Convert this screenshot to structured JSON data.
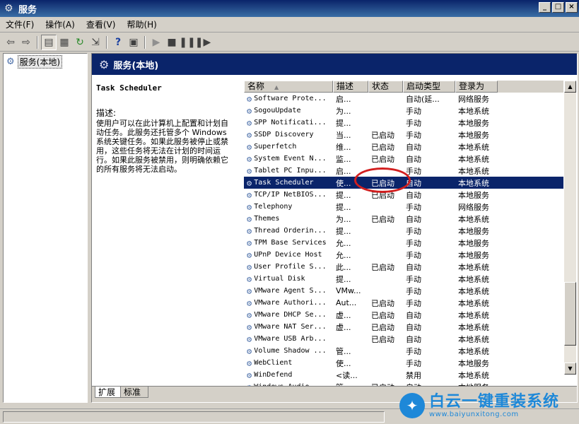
{
  "window": {
    "title": "服务",
    "btn_minimize": "_",
    "btn_maximize": "□",
    "btn_close": "×"
  },
  "menu": [
    {
      "label": "文件(F)"
    },
    {
      "label": "操作(A)"
    },
    {
      "label": "查看(V)"
    },
    {
      "label": "帮助(H)"
    }
  ],
  "toolbar": {
    "icons": [
      "back-icon",
      "forward-icon",
      "show-hide-tree-icon",
      "properties-icon",
      "refresh-icon",
      "export-icon",
      "help-icon",
      "details-view-icon",
      "play-icon",
      "stop-icon",
      "pause-icon",
      "restart-icon"
    ]
  },
  "tree": {
    "root_label": "服务(本地)"
  },
  "header": {
    "title": "服务(本地)"
  },
  "description_pane": {
    "service_name": "Task Scheduler",
    "desc_label": "描述:",
    "desc_text": "使用户可以在此计算机上配置和计划自动任务。此服务还托管多个 Windows 系统关键任务。如果此服务被停止或禁用，这些任务将无法在计划的时间运行。如果此服务被禁用，则明确依赖它的所有服务将无法启动。"
  },
  "columns": [
    "名称",
    "描述",
    "状态",
    "启动类型",
    "登录为"
  ],
  "services": [
    {
      "name": "Software Prote...",
      "desc": "启...",
      "status": "",
      "startup": "自动(延...",
      "logon": "网络服务"
    },
    {
      "name": "SogouUpdate",
      "desc": "为...",
      "status": "",
      "startup": "手动",
      "logon": "本地系统"
    },
    {
      "name": "SPP Notificati...",
      "desc": "提...",
      "status": "",
      "startup": "手动",
      "logon": "本地服务"
    },
    {
      "name": "SSDP Discovery",
      "desc": "当...",
      "status": "已启动",
      "startup": "手动",
      "logon": "本地服务"
    },
    {
      "name": "Superfetch",
      "desc": "维...",
      "status": "已启动",
      "startup": "自动",
      "logon": "本地系统"
    },
    {
      "name": "System Event N...",
      "desc": "监...",
      "status": "已启动",
      "startup": "自动",
      "logon": "本地系统"
    },
    {
      "name": "Tablet PC Inpu...",
      "desc": "启...",
      "status": "",
      "startup": "手动",
      "logon": "本地系统"
    },
    {
      "name": "Task Scheduler",
      "desc": "使...",
      "status": "已启动",
      "startup": "自动",
      "logon": "本地系统",
      "selected": true
    },
    {
      "name": "TCP/IP NetBIOS...",
      "desc": "提...",
      "status": "已启动",
      "startup": "自动",
      "logon": "本地服务"
    },
    {
      "name": "Telephony",
      "desc": "提...",
      "status": "",
      "startup": "手动",
      "logon": "网络服务"
    },
    {
      "name": "Themes",
      "desc": "为...",
      "status": "已启动",
      "startup": "自动",
      "logon": "本地系统"
    },
    {
      "name": "Thread Orderin...",
      "desc": "提...",
      "status": "",
      "startup": "手动",
      "logon": "本地服务"
    },
    {
      "name": "TPM Base Services",
      "desc": "允...",
      "status": "",
      "startup": "手动",
      "logon": "本地服务"
    },
    {
      "name": "UPnP Device Host",
      "desc": "允...",
      "status": "",
      "startup": "手动",
      "logon": "本地服务"
    },
    {
      "name": "User Profile S...",
      "desc": "此...",
      "status": "已启动",
      "startup": "自动",
      "logon": "本地系统"
    },
    {
      "name": "Virtual Disk",
      "desc": "提...",
      "status": "",
      "startup": "手动",
      "logon": "本地系统"
    },
    {
      "name": "VMware Agent S...",
      "desc": "VMw...",
      "status": "",
      "startup": "手动",
      "logon": "本地系统"
    },
    {
      "name": "VMware Authori...",
      "desc": "Aut...",
      "status": "已启动",
      "startup": "手动",
      "logon": "本地系统"
    },
    {
      "name": "VMware DHCP Se...",
      "desc": "虚...",
      "status": "已启动",
      "startup": "自动",
      "logon": "本地系统"
    },
    {
      "name": "VMware NAT Ser...",
      "desc": "虚...",
      "status": "已启动",
      "startup": "自动",
      "logon": "本地系统"
    },
    {
      "name": "VMware USB Arb...",
      "desc": "",
      "status": "已启动",
      "startup": "自动",
      "logon": "本地系统"
    },
    {
      "name": "Volume Shadow ...",
      "desc": "管...",
      "status": "",
      "startup": "手动",
      "logon": "本地系统"
    },
    {
      "name": "WebClient",
      "desc": "使...",
      "status": "",
      "startup": "手动",
      "logon": "本地服务"
    },
    {
      "name": "WinDefend",
      "desc": "<读...",
      "status": "",
      "startup": "禁用",
      "logon": "本地系统"
    },
    {
      "name": "Windows Audio",
      "desc": "管...",
      "status": "已启动",
      "startup": "自动",
      "logon": "本地服务"
    }
  ],
  "scroll": {
    "up_arrow": "▲",
    "down_arrow": "▼"
  },
  "tabs": [
    {
      "label": "扩展"
    },
    {
      "label": "标准"
    }
  ],
  "watermark": {
    "text": "白云一键重装系统",
    "url": "www.baiyunxitong.com"
  },
  "colors": {
    "title_bar": "#0a246a",
    "selected_row": "#0a246a",
    "highlight_circle": "#d21f1f",
    "watermark_blue": "#1e88d8"
  }
}
